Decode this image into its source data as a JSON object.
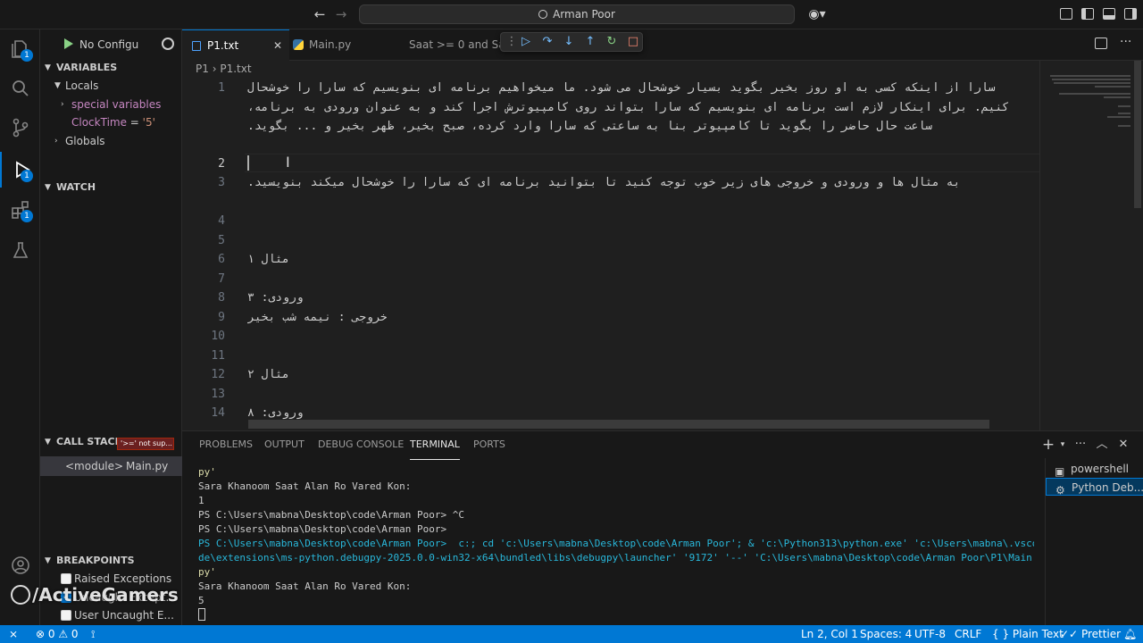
{
  "window": {
    "search_text": "Arman Poor"
  },
  "sidebar": {
    "config_label": "No Configu",
    "variables_header": "VARIABLES",
    "locals_label": "Locals",
    "special_vars_label": "special variables",
    "clock_var_name": "ClockTime",
    "clock_var_eq": " = ",
    "clock_var_value": "'5'",
    "globals_label": "Globals",
    "watch_header": "WATCH",
    "callstack_header": "CALL STACK",
    "paused_badge": "'>=' not sup...",
    "frame_name": "<module>",
    "frame_file": "Main.py",
    "breakpoints_header": "BREAKPOINTS",
    "breakpoints": [
      {
        "label": "Raised Exceptions",
        "checked": false
      },
      {
        "label": "Uncaught Except...",
        "checked": true
      },
      {
        "label": "User Uncaught E...",
        "checked": false
      }
    ]
  },
  "tabs": [
    {
      "label": "P1.txt"
    },
    {
      "label": "Main.py"
    },
    {
      "label": "Saat >= 0 and Saat"
    }
  ],
  "breadcrumb": {
    "folder": "P1",
    "file": "P1.txt"
  },
  "editor": {
    "line_numbers": [
      "1",
      "2",
      "3",
      "4",
      "5",
      "6",
      "7",
      "8",
      "9",
      "10",
      "11",
      "12",
      "13",
      "14"
    ],
    "lines": [
      "سارا از اینکه کسی به او روز بخیر بگوید بسیار خوشحال می شود. ما میخواهیم برنامه ای بنویسیم که سارا را خوشحال کنیم. برای اینکار لازم است برنامه ای بنویسیم که سارا بتواند روی کامپیوترش اجرا کند و به عنوان ورودی به برنامه، ساعت حال حاضر را بگوید تا کامپیوتر بنا به ساعتی که سارا وارد کرده، صبح بخیر، ظهر بخیر و ... بگوید.",
      "",
      "به مثال ها و ورودی و خروجی های زیر خوب توجه کنید تا بتوانید برنامه ای که سارا را خوشحال میکند بنویسید.",
      "",
      "",
      "مثال ۱",
      "",
      "ورودی: ۳",
      "خروجی : نیمه شب بخیر",
      "",
      "",
      "مثال ۲",
      "",
      "ورودی: ۸"
    ]
  },
  "panel": {
    "tabs": [
      "PROBLEMS",
      "OUTPUT",
      "DEBUG CONSOLE",
      "TERMINAL",
      "PORTS"
    ],
    "terminal_lines": [
      "py'",
      "Sara Khanoom Saat Alan Ro Vared Kon:",
      "1",
      "PS C:\\Users\\mabna\\Desktop\\code\\Arman Poor> ^C",
      "PS C:\\Users\\mabna\\Desktop\\code\\Arman Poor>",
      "PS C:\\Users\\mabna\\Desktop\\code\\Arman Poor>  c:; cd 'c:\\Users\\mabna\\Desktop\\code\\Arman Poor'; & 'c:\\Python313\\python.exe' 'c:\\Users\\mabna\\.vsco",
      "de\\extensions\\ms-python.debugpy-2025.0.0-win32-x64\\bundled\\libs\\debugpy\\launcher' '9172' '--' 'C:\\Users\\mabna\\Desktop\\code\\Arman Poor\\P1\\Main.",
      "py'",
      "Sara Khanoom Saat Alan Ro Vared Kon:",
      "5",
      ""
    ],
    "terminal_list": [
      "powershell",
      "Python Deb..."
    ]
  },
  "statusbar": {
    "errors": "0",
    "warnings": "0",
    "position": "Ln 2, Col 1",
    "spaces": "Spaces: 4",
    "encoding": "UTF-8",
    "eol": "CRLF",
    "language": "Plain Text",
    "formatter": "Prettier"
  },
  "watermark": "/ActiveGamers",
  "colors": {
    "accent": "#0078d4",
    "background": "#1f1f1f",
    "sidebar": "#181818"
  }
}
